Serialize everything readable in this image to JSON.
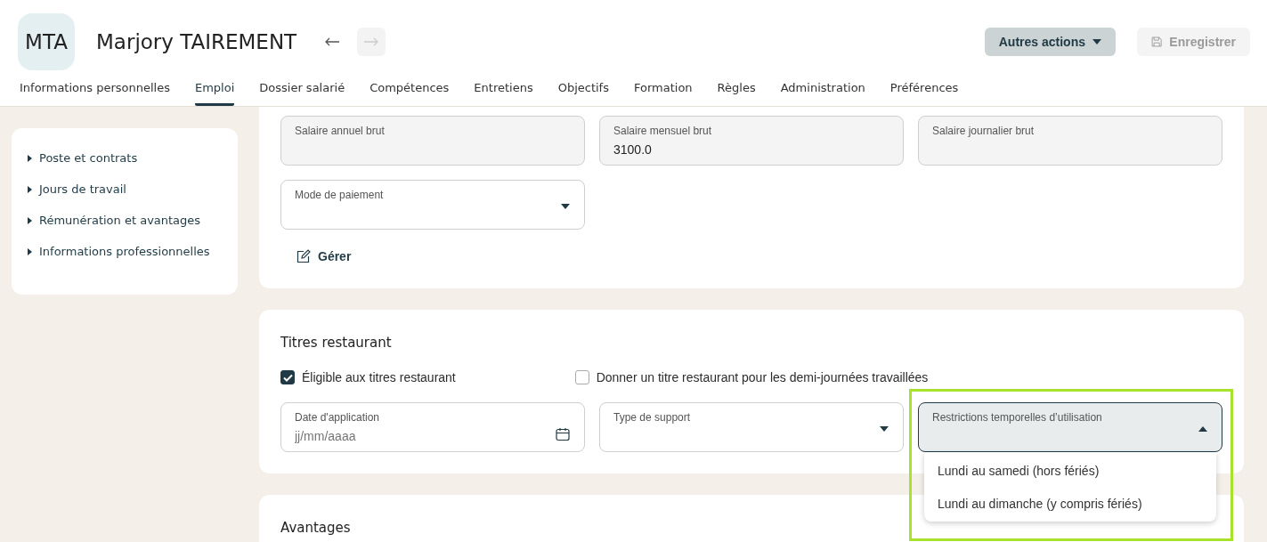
{
  "header": {
    "initials": "MTA",
    "name": "Marjory TAIREMENT",
    "nav": [
      {
        "kind": "prev",
        "disabled": false
      },
      {
        "kind": "next",
        "disabled": true
      }
    ],
    "buttons": [
      {
        "kind": "menu",
        "label": "Autres actions",
        "disabled": false
      },
      {
        "kind": "save",
        "label": "Enregistrer",
        "disabled": true
      }
    ]
  },
  "tabs": [
    {
      "label": "Informations personnelles",
      "selected": false
    },
    {
      "label": "Emploi",
      "selected": true
    },
    {
      "label": "Dossier salarié",
      "selected": false
    },
    {
      "label": "Compétences",
      "selected": false
    },
    {
      "label": "Entretiens",
      "selected": false
    },
    {
      "label": "Objectifs",
      "selected": false
    },
    {
      "label": "Formation",
      "selected": false
    },
    {
      "label": "Règles",
      "selected": false
    },
    {
      "label": "Administration",
      "selected": false
    },
    {
      "label": "Préférences",
      "selected": false
    }
  ],
  "sidebar": {
    "items": [
      {
        "label": "Poste et contrats"
      },
      {
        "label": "Jours de travail"
      },
      {
        "label": "Rémunération et avantages"
      },
      {
        "label": "Informations professionnelles"
      }
    ]
  },
  "salary_section": {
    "fields": [
      {
        "kind": "readonly",
        "label": "Salaire annuel brut"
      },
      {
        "kind": "readonly",
        "label": "Salaire mensuel brut",
        "value": "3100.0"
      },
      {
        "kind": "readonly",
        "label": "Salaire journalier brut"
      },
      {
        "kind": "select",
        "label": "Mode de paiement",
        "expanded": false
      }
    ],
    "manage_link": "Gérer"
  },
  "restaurant_section": {
    "title": "Titres restaurant",
    "checkboxes": [
      {
        "label": "Éligible aux titres restaurant",
        "checked": true
      },
      {
        "label": "Donner un titre restaurant pour les demi-journées travaillées",
        "checked": false
      }
    ],
    "fields": [
      {
        "kind": "date",
        "label": "Date d'application",
        "placeholder": "jj/mm/aaaa"
      },
      {
        "kind": "select",
        "label": "Type de support",
        "expanded": false
      },
      {
        "kind": "select",
        "label": "Restrictions temporelles d’utilisation",
        "expanded": true,
        "highlighted": true,
        "options": [
          "Lundi au samedi (hors fériés)",
          "Lundi au dimanche (y compris fériés)"
        ]
      }
    ]
  },
  "benefits_section": {
    "title": "Avantages"
  }
}
